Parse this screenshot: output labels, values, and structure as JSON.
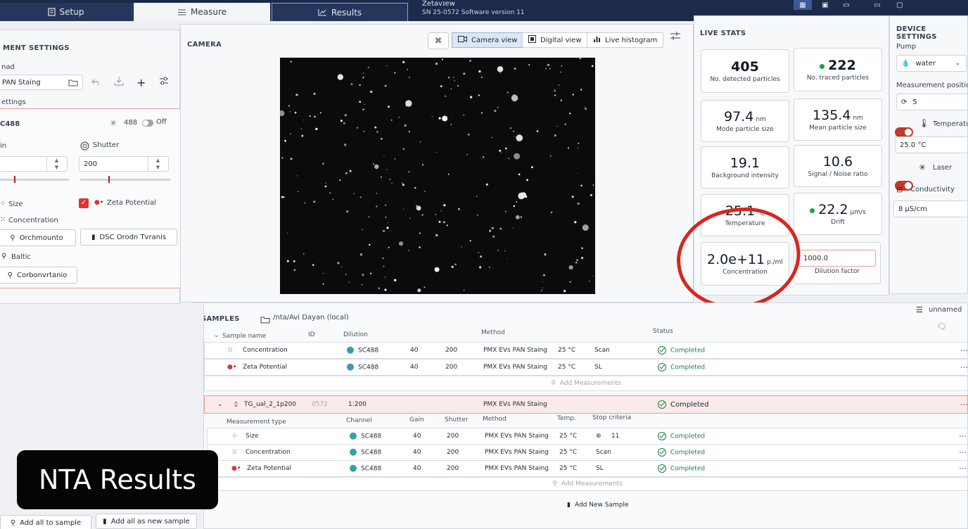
{
  "topbar": {
    "tabs": [
      {
        "label": "Setup",
        "icon": "file-icon"
      },
      {
        "label": "Measure",
        "icon": "list-icon"
      },
      {
        "label": "Results",
        "icon": "chart-icon"
      }
    ],
    "app_name": "Zetaᴠɪew",
    "serial": "SN 25-0572  Software version 11"
  },
  "left": {
    "title": "MENT SETTINGS",
    "method_label": "nad",
    "method_value": "PAN Staing",
    "settings_label": "ettings",
    "channel": "C488",
    "laser_wavelength": "488",
    "laser_state": "Off",
    "gain_label": "in",
    "shutter_label": "Shutter",
    "shutter_value": "200",
    "type_size": "Size",
    "type_zeta": "Zeta Potential",
    "type_concentration": "Concentration",
    "btn_orchmounto": "Orchmounto",
    "btn_dsc": "DSC Orodn Tvranis",
    "btn_baltic": "Baltic",
    "btn_carbon": "Corbonvrtanio",
    "add_all_to_sample": "Add all to sample",
    "add_all_as_new": "Add all as new sample"
  },
  "camera": {
    "title": "CAMERA",
    "views": [
      "Camera view",
      "Digital view",
      "Live histogram"
    ],
    "active_view": "Camera view"
  },
  "stats": {
    "title": "LIVE STATS",
    "detected": {
      "value": "405",
      "caption": "No. detected particles"
    },
    "traced": {
      "value": "222",
      "caption": "No. traced particles"
    },
    "mode_size": {
      "value": "97.4",
      "unit": "nm",
      "caption": "Mode particle size"
    },
    "mean_size": {
      "value": "135.4",
      "unit": "nm",
      "caption": "Mean particle size"
    },
    "background": {
      "value": "19.1",
      "caption": "Background intensity"
    },
    "snr": {
      "value": "10.6",
      "caption": "Signal / Noise ratio"
    },
    "temperature": {
      "value": "25.1",
      "unit": "°C",
      "caption": "Temperature"
    },
    "drift": {
      "value": "22.2",
      "unit": "µm/s",
      "caption": "Drift"
    },
    "concentration": {
      "value": "2.0e+11",
      "unit": "p./ml",
      "caption": "Concentration"
    },
    "dilution": {
      "value": "1000.0",
      "caption": "Dilution factor"
    }
  },
  "device": {
    "title": "DEVICE SETTINGS",
    "pump_label": "Pump",
    "pump_value": "water",
    "position_label": "Measurement positio",
    "position_value": "5",
    "temperature_label": "Temperatu",
    "temperature_value": "25.0 °C",
    "laser_label": "Laser",
    "conductivity_label": "Conductivity",
    "conductivity_value": "8 µS/cm"
  },
  "samples": {
    "title": "SAMPLES",
    "path": "/nta/Avi Dayan (local)",
    "unnamed": "unnamed",
    "headers": {
      "sample_name": "Sample name",
      "id": "ID",
      "dilution": "Dilution",
      "method": "Method",
      "status": "Status"
    },
    "group1": [
      {
        "name": "Concentration",
        "channel": "SC488",
        "gain": "40",
        "shutter": "200",
        "method": "PMX EVs PAN Staing",
        "temp": "25 °C",
        "stop": "Scan",
        "status": "Completed"
      },
      {
        "name": "Zeta Potential",
        "channel": "SC488",
        "gain": "40",
        "shutter": "200",
        "method": "PMX EVs PAN Staing",
        "temp": "25 °C",
        "stop": "SL",
        "status": "Completed"
      }
    ],
    "add_measurements": "Add Measurements",
    "sample2": {
      "name": "TG_ual_2_1p200",
      "id": "0572",
      "dilution": "1:200",
      "method": "PMX EVs PAN Staing",
      "status": "Completed"
    },
    "sub_headers": {
      "type": "Measurement type",
      "channel": "Channel",
      "gain": "Gain",
      "shutter": "Shutter",
      "method": "Method",
      "temp": "Temp.",
      "stop": "Stop criteria"
    },
    "group2": [
      {
        "name": "Size",
        "channel": "SC488",
        "gain": "40",
        "shutter": "200",
        "method": "PMX EVs PAN Staing",
        "temp": "25 °C",
        "stop": "11",
        "status": "Completed"
      },
      {
        "name": "Concentration",
        "channel": "SC488",
        "gain": "40",
        "shutter": "200",
        "method": "PMX EVs PAN Staing",
        "temp": "25 °C",
        "stop": "Scan",
        "status": "Completed"
      },
      {
        "name": "Zeta Potential",
        "channel": "SC488",
        "gain": "40",
        "shutter": "200",
        "method": "PMX EVs PAN Staing",
        "temp": "25 °C",
        "stop": "SL",
        "status": "Completed"
      }
    ],
    "add_new_sample": "Add New Sample"
  },
  "overlay_label": "NTA Results",
  "colors": {
    "accent": "#1c2b4b",
    "success": "#15803d",
    "annotation": "#d7261e",
    "channel": "#3b9bb5"
  }
}
